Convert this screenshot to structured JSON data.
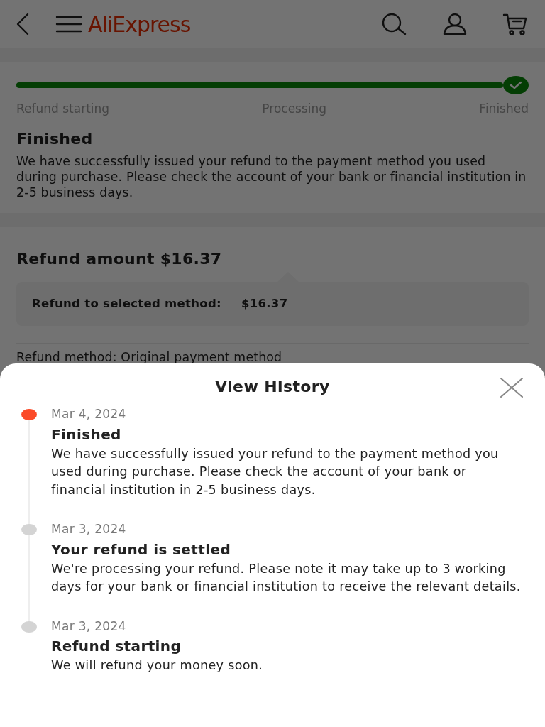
{
  "header": {
    "logo": "AliExpress"
  },
  "progress": {
    "level": 1,
    "done": true,
    "steps": [
      {
        "label": "Refund starting"
      },
      {
        "label": "Processing"
      },
      {
        "label": "Finished"
      }
    ]
  },
  "status": {
    "title": "Finished",
    "text": "We have successfully issued your refund to the payment method you used during purchase. Please check the account of your bank or financial institution in 2-5 business days."
  },
  "refund": {
    "title": "Refund amount $16.37",
    "method_label": "Refund to selected method:",
    "method_amount": "$16.37",
    "method_line": "Refund method: Original payment method"
  },
  "history": {
    "title": "View History",
    "events": [
      {
        "date": "Mar 4, 2024",
        "title": "Finished",
        "text": "We have successfully issued your refund to the payment method you used during purchase. Please check the account of your bank or financial institution in 2-5 business days.",
        "current": true
      },
      {
        "date": "Mar 3, 2024",
        "title": "Your refund is settled",
        "text": "We're processing your refund. Please note it may take up to 3 working days for your bank or financial institution to receive the relevant details.",
        "current": false
      },
      {
        "date": "Mar 3, 2024",
        "title": "Refund starting",
        "text": "We will refund your money soon.",
        "current": false
      }
    ]
  }
}
